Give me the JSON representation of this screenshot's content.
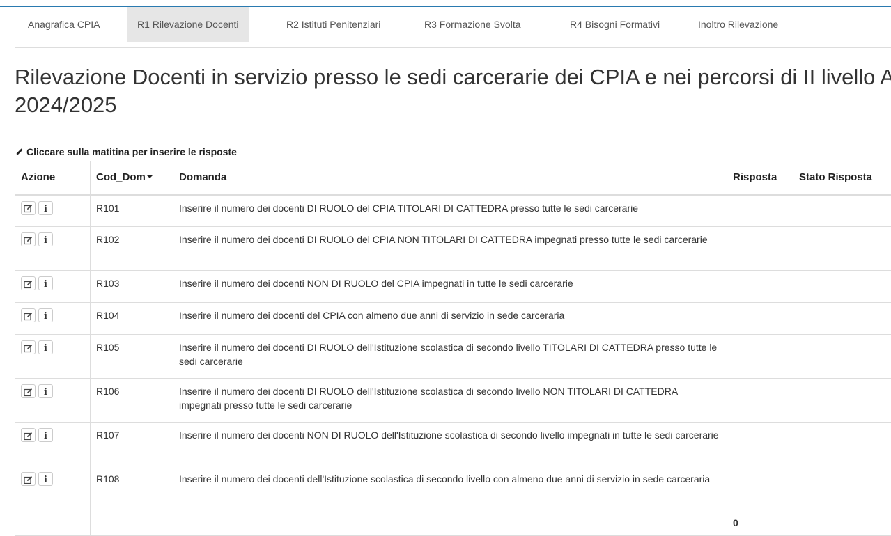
{
  "tabs": [
    {
      "label": "Anagrafica CPIA"
    },
    {
      "label": "R1 Rilevazione Docenti"
    },
    {
      "label": "R2 Istituti Penitenziari"
    },
    {
      "label": "R3 Formazione Svolta"
    },
    {
      "label": "R4 Bisogni Formativi"
    },
    {
      "label": "Inoltro Rilevazione"
    }
  ],
  "active_tab": "R1 Rilevazione Docenti",
  "page": {
    "title_line1": "Rilevazione Docenti in servizio presso le sedi carcerarie dei CPIA e nei percorsi di II livello A.S.",
    "title_line2": "2024/2025",
    "instruction": "Cliccare sulla matitina per inserire le risposte"
  },
  "table": {
    "columns": {
      "azione": "Azione",
      "cod_dom": "Cod_Dom",
      "domanda": "Domanda",
      "risposta": "Risposta",
      "stato_risposta": "Stato Risposta"
    },
    "rows": [
      {
        "cod": "R101",
        "domanda": "Inserire il numero dei docenti DI RUOLO del CPIA TITOLARI DI CATTEDRA presso tutte le sedi carcerarie",
        "risposta": "",
        "stato": ""
      },
      {
        "cod": "R102",
        "domanda": "Inserire il numero dei docenti DI RUOLO del CPIA NON TITOLARI DI CATTEDRA impegnati presso tutte le sedi carcerarie",
        "risposta": "",
        "stato": ""
      },
      {
        "cod": "R103",
        "domanda": "Inserire il numero dei docenti NON DI RUOLO del CPIA impegnati in tutte le sedi carcerarie",
        "risposta": "",
        "stato": ""
      },
      {
        "cod": "R104",
        "domanda": "Inserire il numero dei docenti del CPIA con almeno due anni di servizio in sede carceraria",
        "risposta": "",
        "stato": ""
      },
      {
        "cod": "R105",
        "domanda": "Inserire il numero dei docenti DI RUOLO dell'Istituzione scolastica di secondo livello TITOLARI DI CATTEDRA presso tutte le sedi carcerarie",
        "risposta": "",
        "stato": ""
      },
      {
        "cod": "R106",
        "domanda": "Inserire il numero dei docenti DI RUOLO dell'Istituzione scolastica di secondo livello NON TITOLARI DI CATTEDRA impegnati presso tutte le sedi carcerarie",
        "risposta": "",
        "stato": ""
      },
      {
        "cod": "R107",
        "domanda": "Inserire il numero dei docenti NON DI RUOLO dell'Istituzione scolastica di secondo livello impegnati in tutte le sedi carcerarie",
        "risposta": "",
        "stato": ""
      },
      {
        "cod": "R108",
        "domanda": "Inserire il numero dei docenti dell'Istituzione scolastica di secondo livello con almeno due anni di servizio in sede carceraria",
        "risposta": "",
        "stato": ""
      }
    ],
    "total_risposta": "0"
  },
  "icons": {
    "edit": "edit-icon",
    "info": "info-icon",
    "pencil": "pencil-icon",
    "sort": "sort-caret-icon"
  },
  "colors": {
    "active_tab_bg": "#e6e6e6",
    "top_border": "#2a7ab0",
    "grid_border": "#dddddd"
  }
}
